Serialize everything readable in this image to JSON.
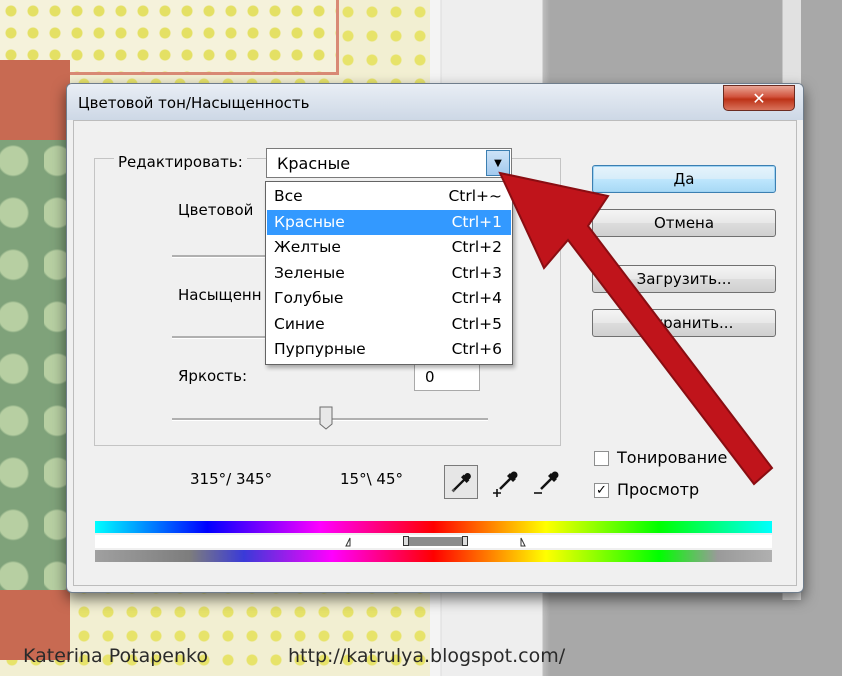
{
  "dialog": {
    "title": "Цветовой тон/Насыщенность",
    "close_glyph": "✕"
  },
  "edit": {
    "label": "Редактировать:",
    "value": "Красные",
    "arrow_glyph": "▼"
  },
  "dropdown": {
    "items": [
      {
        "name": "Все",
        "shortcut": "Ctrl+~",
        "selected": false
      },
      {
        "name": "Красные",
        "shortcut": "Ctrl+1",
        "selected": true
      },
      {
        "name": "Желтые",
        "shortcut": "Ctrl+2",
        "selected": false
      },
      {
        "name": "Зеленые",
        "shortcut": "Ctrl+3",
        "selected": false
      },
      {
        "name": "Голубые",
        "shortcut": "Ctrl+4",
        "selected": false
      },
      {
        "name": "Синие",
        "shortcut": "Ctrl+5",
        "selected": false
      },
      {
        "name": "Пурпурные",
        "shortcut": "Ctrl+6",
        "selected": false
      }
    ]
  },
  "sliders": {
    "hue_label": "Цветовой",
    "saturation_label": "Насыщенн",
    "brightness_label": "Яркость:",
    "brightness_value": "0"
  },
  "buttons": {
    "ok": "Да",
    "cancel": "Отмена",
    "load": "Загрузить...",
    "save": "Сохранить..."
  },
  "options": {
    "colorize_label": "Тонирование",
    "colorize_checked": false,
    "preview_label": "Просмотр",
    "preview_checked": true,
    "check_glyph": "✓"
  },
  "ranges": {
    "left": "315°/ 345°",
    "right": "15°\\ 45°"
  },
  "footer": {
    "author": "Katerina Potapenko",
    "url": "http://katrulya.blogspot.com/"
  },
  "colors": {
    "accent_selection": "#3399ff",
    "arrow": "#c0141b"
  }
}
